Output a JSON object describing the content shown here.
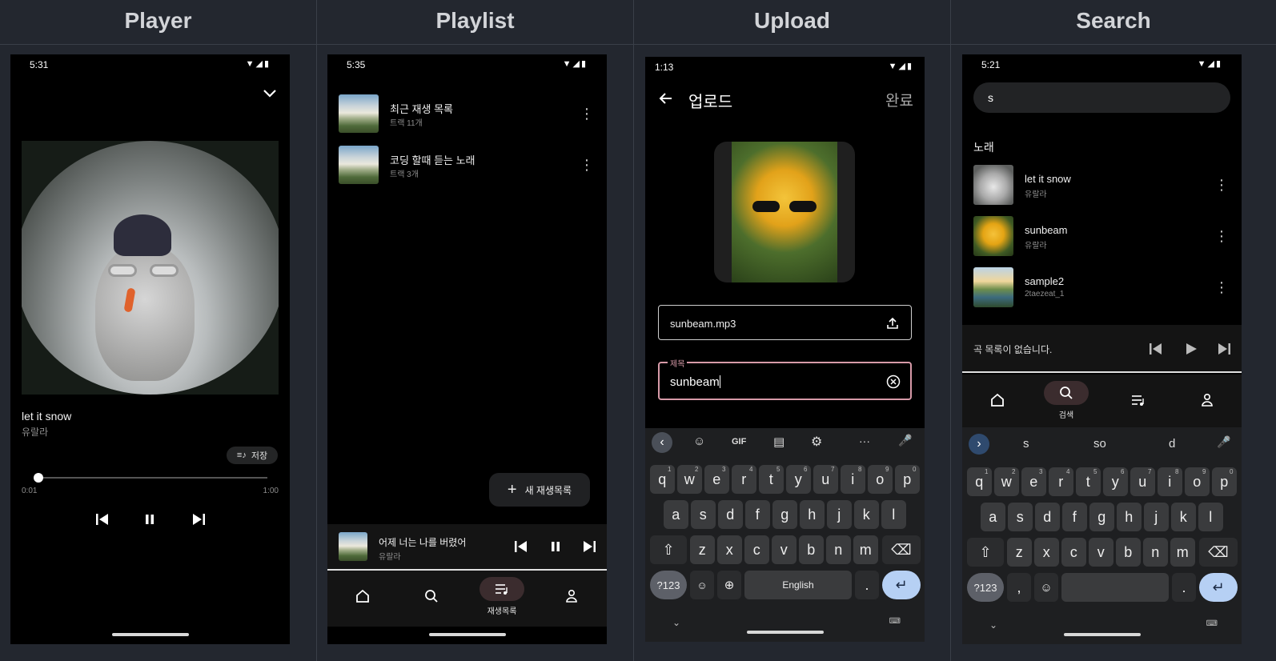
{
  "panels": {
    "player": "Player",
    "playlist": "Playlist",
    "upload": "Upload",
    "search": "Search"
  },
  "player": {
    "status_time": "5:31",
    "track_title": "let it snow",
    "track_artist": "유랄라",
    "save_label": "저장",
    "elapsed": "0:01",
    "duration": "1:00",
    "progress_fraction": 0.017
  },
  "playlist": {
    "status_time": "5:35",
    "items": [
      {
        "title": "최근 재생 목록",
        "subtitle": "트랙 11개"
      },
      {
        "title": "코딩 할때 듣는 노래",
        "subtitle": "트랙 3개"
      }
    ],
    "new_playlist_label": "새 재생목록",
    "mini_player": {
      "title": "어제 너는 나를 버렸어",
      "artist": "유랄라"
    },
    "nav": {
      "active_label": "재생목록"
    }
  },
  "upload": {
    "status_time": "1:13",
    "header_title": "업로드",
    "done_label": "완료",
    "file_value": "sunbeam.mp3",
    "title_field_label": "제목",
    "title_field_value": "sunbeam",
    "keyboard": {
      "toolbar": [
        "‹",
        "☺",
        "GIF",
        "▤",
        "⚙",
        "···",
        "🎤"
      ],
      "row1": [
        [
          "q",
          "1"
        ],
        [
          "w",
          "2"
        ],
        [
          "e",
          "3"
        ],
        [
          "r",
          "4"
        ],
        [
          "t",
          "5"
        ],
        [
          "y",
          "6"
        ],
        [
          "u",
          "7"
        ],
        [
          "i",
          "8"
        ],
        [
          "o",
          "9"
        ],
        [
          "p",
          "0"
        ]
      ],
      "row2": [
        "a",
        "s",
        "d",
        "f",
        "g",
        "h",
        "j",
        "k",
        "l"
      ],
      "row3": [
        "z",
        "x",
        "c",
        "v",
        "b",
        "n",
        "m"
      ],
      "symbols_label": "?123",
      "space_label": "English",
      "period_label": "."
    }
  },
  "search": {
    "status_time": "5:21",
    "query": "s",
    "section_label": "노래",
    "results": [
      {
        "title": "let it snow",
        "subtitle": "유랄라"
      },
      {
        "title": "sunbeam",
        "subtitle": "유랄라"
      },
      {
        "title": "sample2",
        "subtitle": "2taezeat_1"
      }
    ],
    "empty_queue": "곡 목록이 없습니다.",
    "nav": {
      "active_label": "검색"
    },
    "suggestions": [
      "s",
      "so",
      "d"
    ],
    "keyboard": {
      "row1": [
        [
          "q",
          "1"
        ],
        [
          "w",
          "2"
        ],
        [
          "e",
          "3"
        ],
        [
          "r",
          "4"
        ],
        [
          "t",
          "5"
        ],
        [
          "y",
          "6"
        ],
        [
          "u",
          "7"
        ],
        [
          "i",
          "8"
        ],
        [
          "o",
          "9"
        ],
        [
          "p",
          "0"
        ]
      ],
      "row2": [
        "a",
        "s",
        "d",
        "f",
        "g",
        "h",
        "j",
        "k",
        "l"
      ],
      "row3": [
        "z",
        "x",
        "c",
        "v",
        "b",
        "n",
        "m"
      ],
      "symbols_label": "?123",
      "comma_label": ",",
      "period_label": "."
    }
  },
  "colors": {
    "panel_bg": "#23272f",
    "accent_field": "#d79aa8",
    "active_nav": "#3b2c2e",
    "enter_key": "#b6d0f4"
  }
}
